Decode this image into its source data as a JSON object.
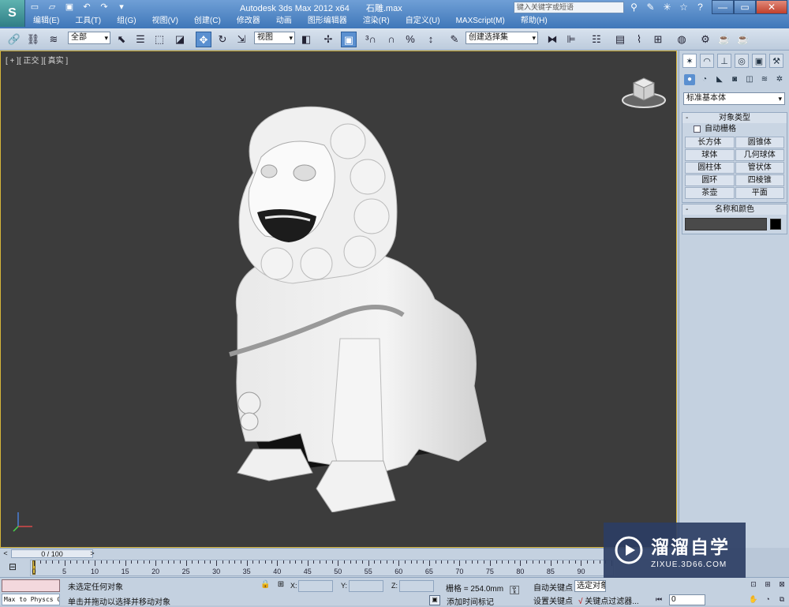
{
  "titlebar": {
    "app_title": "Autodesk 3ds Max  2012 x64",
    "file_name": "石雕.max",
    "search_placeholder": "键入关键字或短语"
  },
  "menu": [
    "编辑(E)",
    "工具(T)",
    "组(G)",
    "视图(V)",
    "创建(C)",
    "修改器",
    "动画",
    "图形编辑器",
    "渲染(R)",
    "自定义(U)",
    "MAXScript(M)",
    "帮助(H)"
  ],
  "toolbar": {
    "selection_filter": "全部",
    "reference_coord": "视图",
    "named_selection": "创建选择集"
  },
  "viewport": {
    "label": "[ + ][ 正交 ][ 真实 ]"
  },
  "command_panel": {
    "category": "标准基本体",
    "object_type_title": "对象类型",
    "autogrid_label": "自动栅格",
    "object_buttons": [
      "长方体",
      "圆锥体",
      "球体",
      "几何球体",
      "圆柱体",
      "管状体",
      "圆环",
      "四棱锥",
      "茶壶",
      "平面"
    ],
    "name_color_title": "名称和颜色",
    "object_color": "#000000"
  },
  "timeslider": {
    "position": "0 / 100",
    "left_arrow": "<",
    "right_arrow": ">"
  },
  "trackbar": {
    "ticks": [
      "0",
      "5",
      "10",
      "15",
      "20",
      "25",
      "30",
      "35",
      "40",
      "45",
      "50",
      "55",
      "60",
      "65",
      "70",
      "75",
      "80",
      "85",
      "90"
    ]
  },
  "statusbar": {
    "maxscript_text": "Max to Physcs Conv",
    "status": "未选定任何对象",
    "prompt": "单击并拖动以选择并移动对象",
    "x_label": "X:",
    "y_label": "Y:",
    "z_label": "Z:",
    "grid": "栅格 = 254.0mm",
    "time_tag": "添加时间标记",
    "autokey": "自动关键点",
    "setkey": "设置关键点",
    "selection_set": "选定对象",
    "key_filters": "关键点过滤器...",
    "current_frame": "0"
  },
  "watermark": {
    "title": "溜溜自学",
    "url": "ZIXUE.3D66.COM"
  }
}
